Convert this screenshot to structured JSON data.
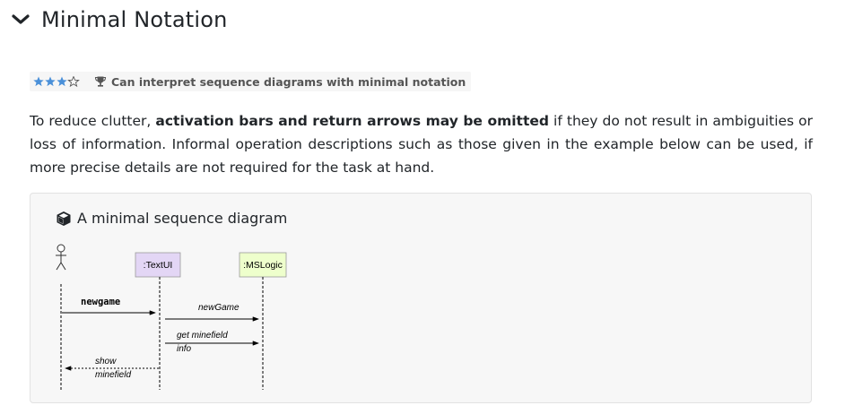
{
  "section": {
    "title": "Minimal Notation",
    "collapse_icon": "chevron-down-icon"
  },
  "badge": {
    "stars_filled": 3,
    "stars_total": 4,
    "text": "Can interpret sequence diagrams with minimal notation",
    "icon": "trophy-icon",
    "star_color": "#4a90d9"
  },
  "paragraph": {
    "part1": "To reduce clutter, ",
    "bold": "activation bars and return arrows may be omitted",
    "part2": " if they do not result in ambiguities or loss of information. Informal operation descriptions such as those given in the example below can be used, if more precise details are not required for the task at hand."
  },
  "example": {
    "icon": "cube-icon",
    "title": "A minimal sequence diagram",
    "diagram": {
      "lifelines": [
        ":TextUI",
        ":MSLogic"
      ],
      "lifeline_colors": [
        "#e3d6f5",
        "#eeffcc"
      ],
      "messages": {
        "m1": "newgame",
        "m2": "newGame",
        "m3_line1": "get minefield",
        "m3_line2": "info",
        "m4_line1": "show",
        "m4_line2": "minefield"
      }
    }
  }
}
